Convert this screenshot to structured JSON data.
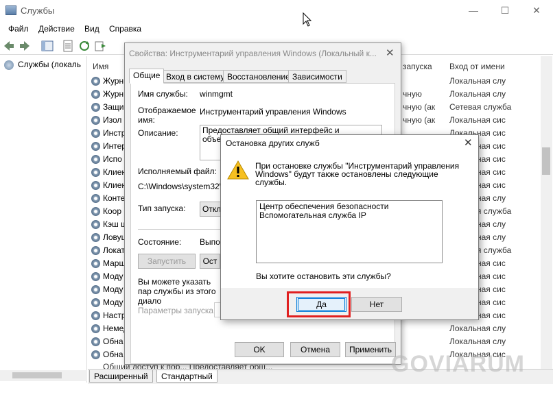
{
  "window": {
    "title": "Службы",
    "icon": "services-icon"
  },
  "menu": [
    "Файл",
    "Действие",
    "Вид",
    "Справка"
  ],
  "tree": {
    "root": "Службы (локаль"
  },
  "list": {
    "headers": {
      "name": "Имя",
      "startup": "запуска",
      "logon": "Вход от имени"
    },
    "rows": [
      {
        "name": "Журн",
        "startup": "",
        "logon": "Локальная слу"
      },
      {
        "name": "Журн",
        "startup": "чную",
        "logon": "Локальная слу"
      },
      {
        "name": "Защи",
        "startup": "чную (ак",
        "logon": "Сетевая служба"
      },
      {
        "name": "Изол",
        "startup": "чную (ак",
        "logon": "Локальная сис"
      },
      {
        "name": "Инстр",
        "startup": "",
        "logon": "Локальная сис"
      },
      {
        "name": "Интер",
        "startup": "",
        "logon": "Локальная сис"
      },
      {
        "name": "Испо",
        "startup": "",
        "logon": "Локальная сис"
      },
      {
        "name": "Клиен",
        "startup": "",
        "logon": "Локальная сис"
      },
      {
        "name": "Клиен",
        "startup": "",
        "logon": "Локальная сис"
      },
      {
        "name": "Конте",
        "startup": "",
        "logon": "Локальная слу"
      },
      {
        "name": "Коор",
        "startup": "",
        "logon": "Сетевая служба"
      },
      {
        "name": "Кэш ш",
        "startup": "",
        "logon": "Локальная слу"
      },
      {
        "name": "Ловуш",
        "startup": "",
        "logon": "Локальная слу"
      },
      {
        "name": "Локат",
        "startup": "",
        "logon": "Сетевая служба"
      },
      {
        "name": "Марш",
        "startup": "",
        "logon": "Локальная сис"
      },
      {
        "name": "Моду",
        "startup": "",
        "logon": "Локальная сис"
      },
      {
        "name": "Моду",
        "startup": "",
        "logon": "Локальная сис"
      },
      {
        "name": "Моду",
        "startup": "",
        "logon": "Локальная сис"
      },
      {
        "name": "Настр",
        "startup": "",
        "logon": "Локальная сис"
      },
      {
        "name": "Немед",
        "startup": "",
        "logon": "Локальная слу"
      },
      {
        "name": "Обна",
        "startup": "",
        "logon": "Локальная слу"
      },
      {
        "name": "Обна",
        "startup": "",
        "logon": "Локальная сис"
      },
      {
        "name": "Обще",
        "startup": "",
        "logon": "Локальная сис"
      }
    ],
    "partial_row": "Общий доступ к пор... Предоставляет общ..."
  },
  "bottom_tabs": [
    "Расширенный",
    "Стандартный"
  ],
  "props": {
    "title": "Свойства: Инструментарий управления Windows (Локальный к...",
    "tabs": [
      "Общие",
      "Вход в систему",
      "Восстановление",
      "Зависимости"
    ],
    "service_name_label": "Имя службы:",
    "service_name": "winmgmt",
    "display_name_label": "Отображаемое имя:",
    "display_name": "Инструментарий управления Windows",
    "description_label": "Описание:",
    "description": "Предоставляет общий интерфейс и объектную моде упра устро",
    "exe_label": "Исполняемый файл:",
    "exe_path": "C:\\Windows\\system32\\s",
    "startup_label": "Тип запуска:",
    "startup_value": "Откл",
    "status_label": "Состояние:",
    "status_value": "Выпо",
    "start_button": "Запустить",
    "stop_button": "Ост",
    "hint": "Вы можете указать пар службы из этого диало",
    "params_label": "Параметры запуска:",
    "ok": "OK",
    "cancel": "Отмена",
    "apply": "Применить"
  },
  "dialog": {
    "title": "Остановка других служб",
    "message": "При остановке службы \"Инструментарий управления Windows\" будут также остановлены следующие службы.",
    "services": [
      "Центр обеспечения безопасности",
      "Вспомогательная служба IP"
    ],
    "question": "Вы хотите остановить эти службы?",
    "yes": "Да",
    "no": "Нет"
  },
  "watermark": "GOVIARUM"
}
